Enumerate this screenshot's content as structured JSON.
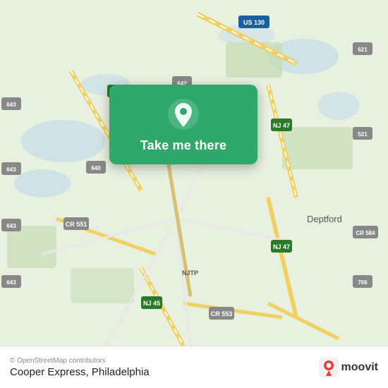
{
  "map": {
    "attribution": "© OpenStreetMap contributors"
  },
  "popup": {
    "label": "Take me there",
    "pin_icon": "location-pin-icon"
  },
  "bottom_bar": {
    "copyright": "© OpenStreetMap contributors",
    "location": "Cooper Express, Philadelphia",
    "moovit_label": "moovit"
  },
  "colors": {
    "popup_bg": "#2ea86b",
    "map_bg": "#e8f0e8",
    "road_yellow": "#f5d96b",
    "road_white": "#ffffff",
    "water": "#b8d8e8",
    "land_light": "#dce9d5"
  }
}
